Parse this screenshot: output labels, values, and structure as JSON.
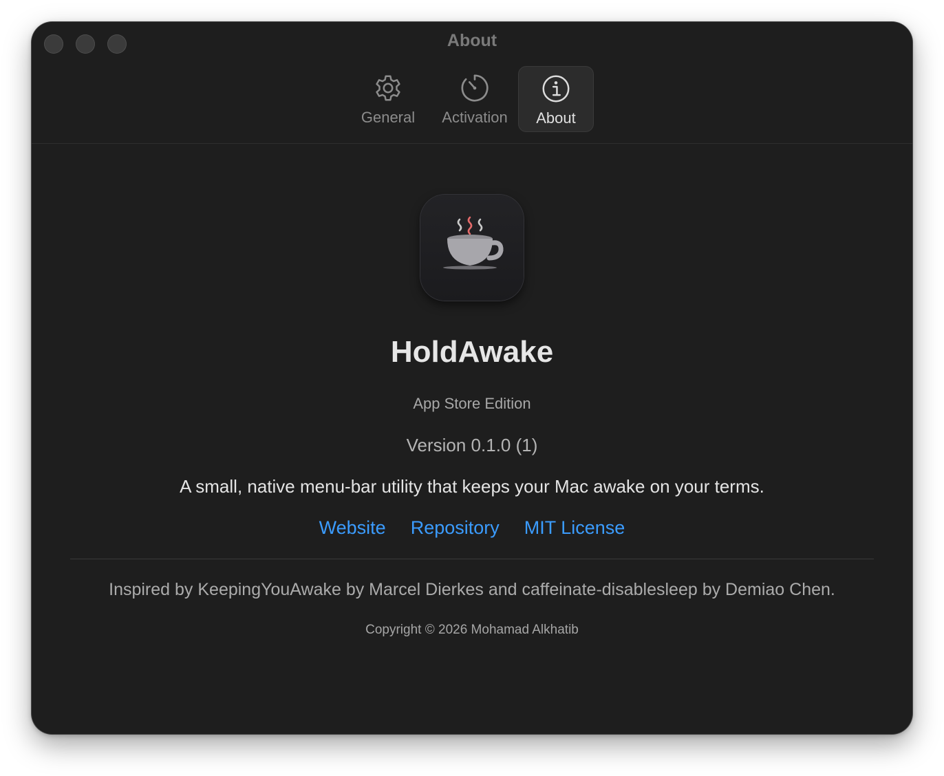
{
  "window": {
    "title": "About"
  },
  "tabs": [
    {
      "label": "General",
      "icon": "gear-icon",
      "selected": false
    },
    {
      "label": "Activation",
      "icon": "timer-icon",
      "selected": false
    },
    {
      "label": "About",
      "icon": "info-icon",
      "selected": true
    }
  ],
  "about": {
    "app_icon": "coffee-cup-icon",
    "app_name": "HoldAwake",
    "edition": "App Store Edition",
    "version": "Version 0.1.0 (1)",
    "description": "A small, native menu-bar utility that keeps your Mac awake on your terms.",
    "links": [
      {
        "label": "Website"
      },
      {
        "label": "Repository"
      },
      {
        "label": "MIT License"
      }
    ],
    "credits": "Inspired by KeepingYouAwake by Marcel Dierkes and caffeinate-disablesleep by Demiao Chen.",
    "copyright": "Copyright © 2026 Mohamad Alkhatib"
  },
  "colors": {
    "window_background": "#1e1e1e",
    "link": "#3b9cff",
    "steam_accent": "#e46a6a",
    "cup": "#a7a6ab"
  }
}
